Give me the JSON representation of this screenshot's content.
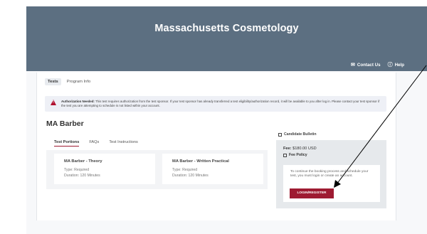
{
  "header": {
    "site_title": "Massachusetts Cosmetology",
    "contact_label": "Contact Us",
    "help_label": "Help",
    "contact_icon": "envelope-icon",
    "help_icon": "question-circle-icon",
    "background": "#5c6f81"
  },
  "top_tabs": [
    {
      "label": "Tests",
      "active": true
    },
    {
      "label": "Program Info",
      "active": false
    }
  ],
  "alert": {
    "title": "Authorization Needed:",
    "message": "This test requires authorization from the test sponsor. If your test sponsor has already transferred a test eligibility/authorization record, it will be available to you after log in. Please contact your test sponsor if the test you are attempting to schedule is not listed within your account.",
    "icon": "warning-triangle-icon",
    "icon_color": "#b0102e"
  },
  "page_title": "MA Barber",
  "content_tabs": [
    {
      "label": "Test Portions",
      "active": true
    },
    {
      "label": "FAQs",
      "active": false
    },
    {
      "label": "Test Instructions",
      "active": false
    }
  ],
  "portions": [
    {
      "name": "MA Barber - Theory",
      "type": "Type: Required",
      "duration": "Duration: 120 Minutes"
    },
    {
      "name": "MA Barber - Written Practical",
      "type": "Type: Required",
      "duration": "Duration: 120 Minutes"
    }
  ],
  "sidebar": {
    "bulletin_label": "Candidate Bulletin",
    "fee_label": "Fee:",
    "fee_value": "$180.00 USD",
    "fee_policy_label": "Fee Policy",
    "login_text": "To continue the booking process and schedule your test, you must login or create an account.",
    "login_button": "LOGIN/REGISTER",
    "accent_color": "#9e1b32"
  }
}
